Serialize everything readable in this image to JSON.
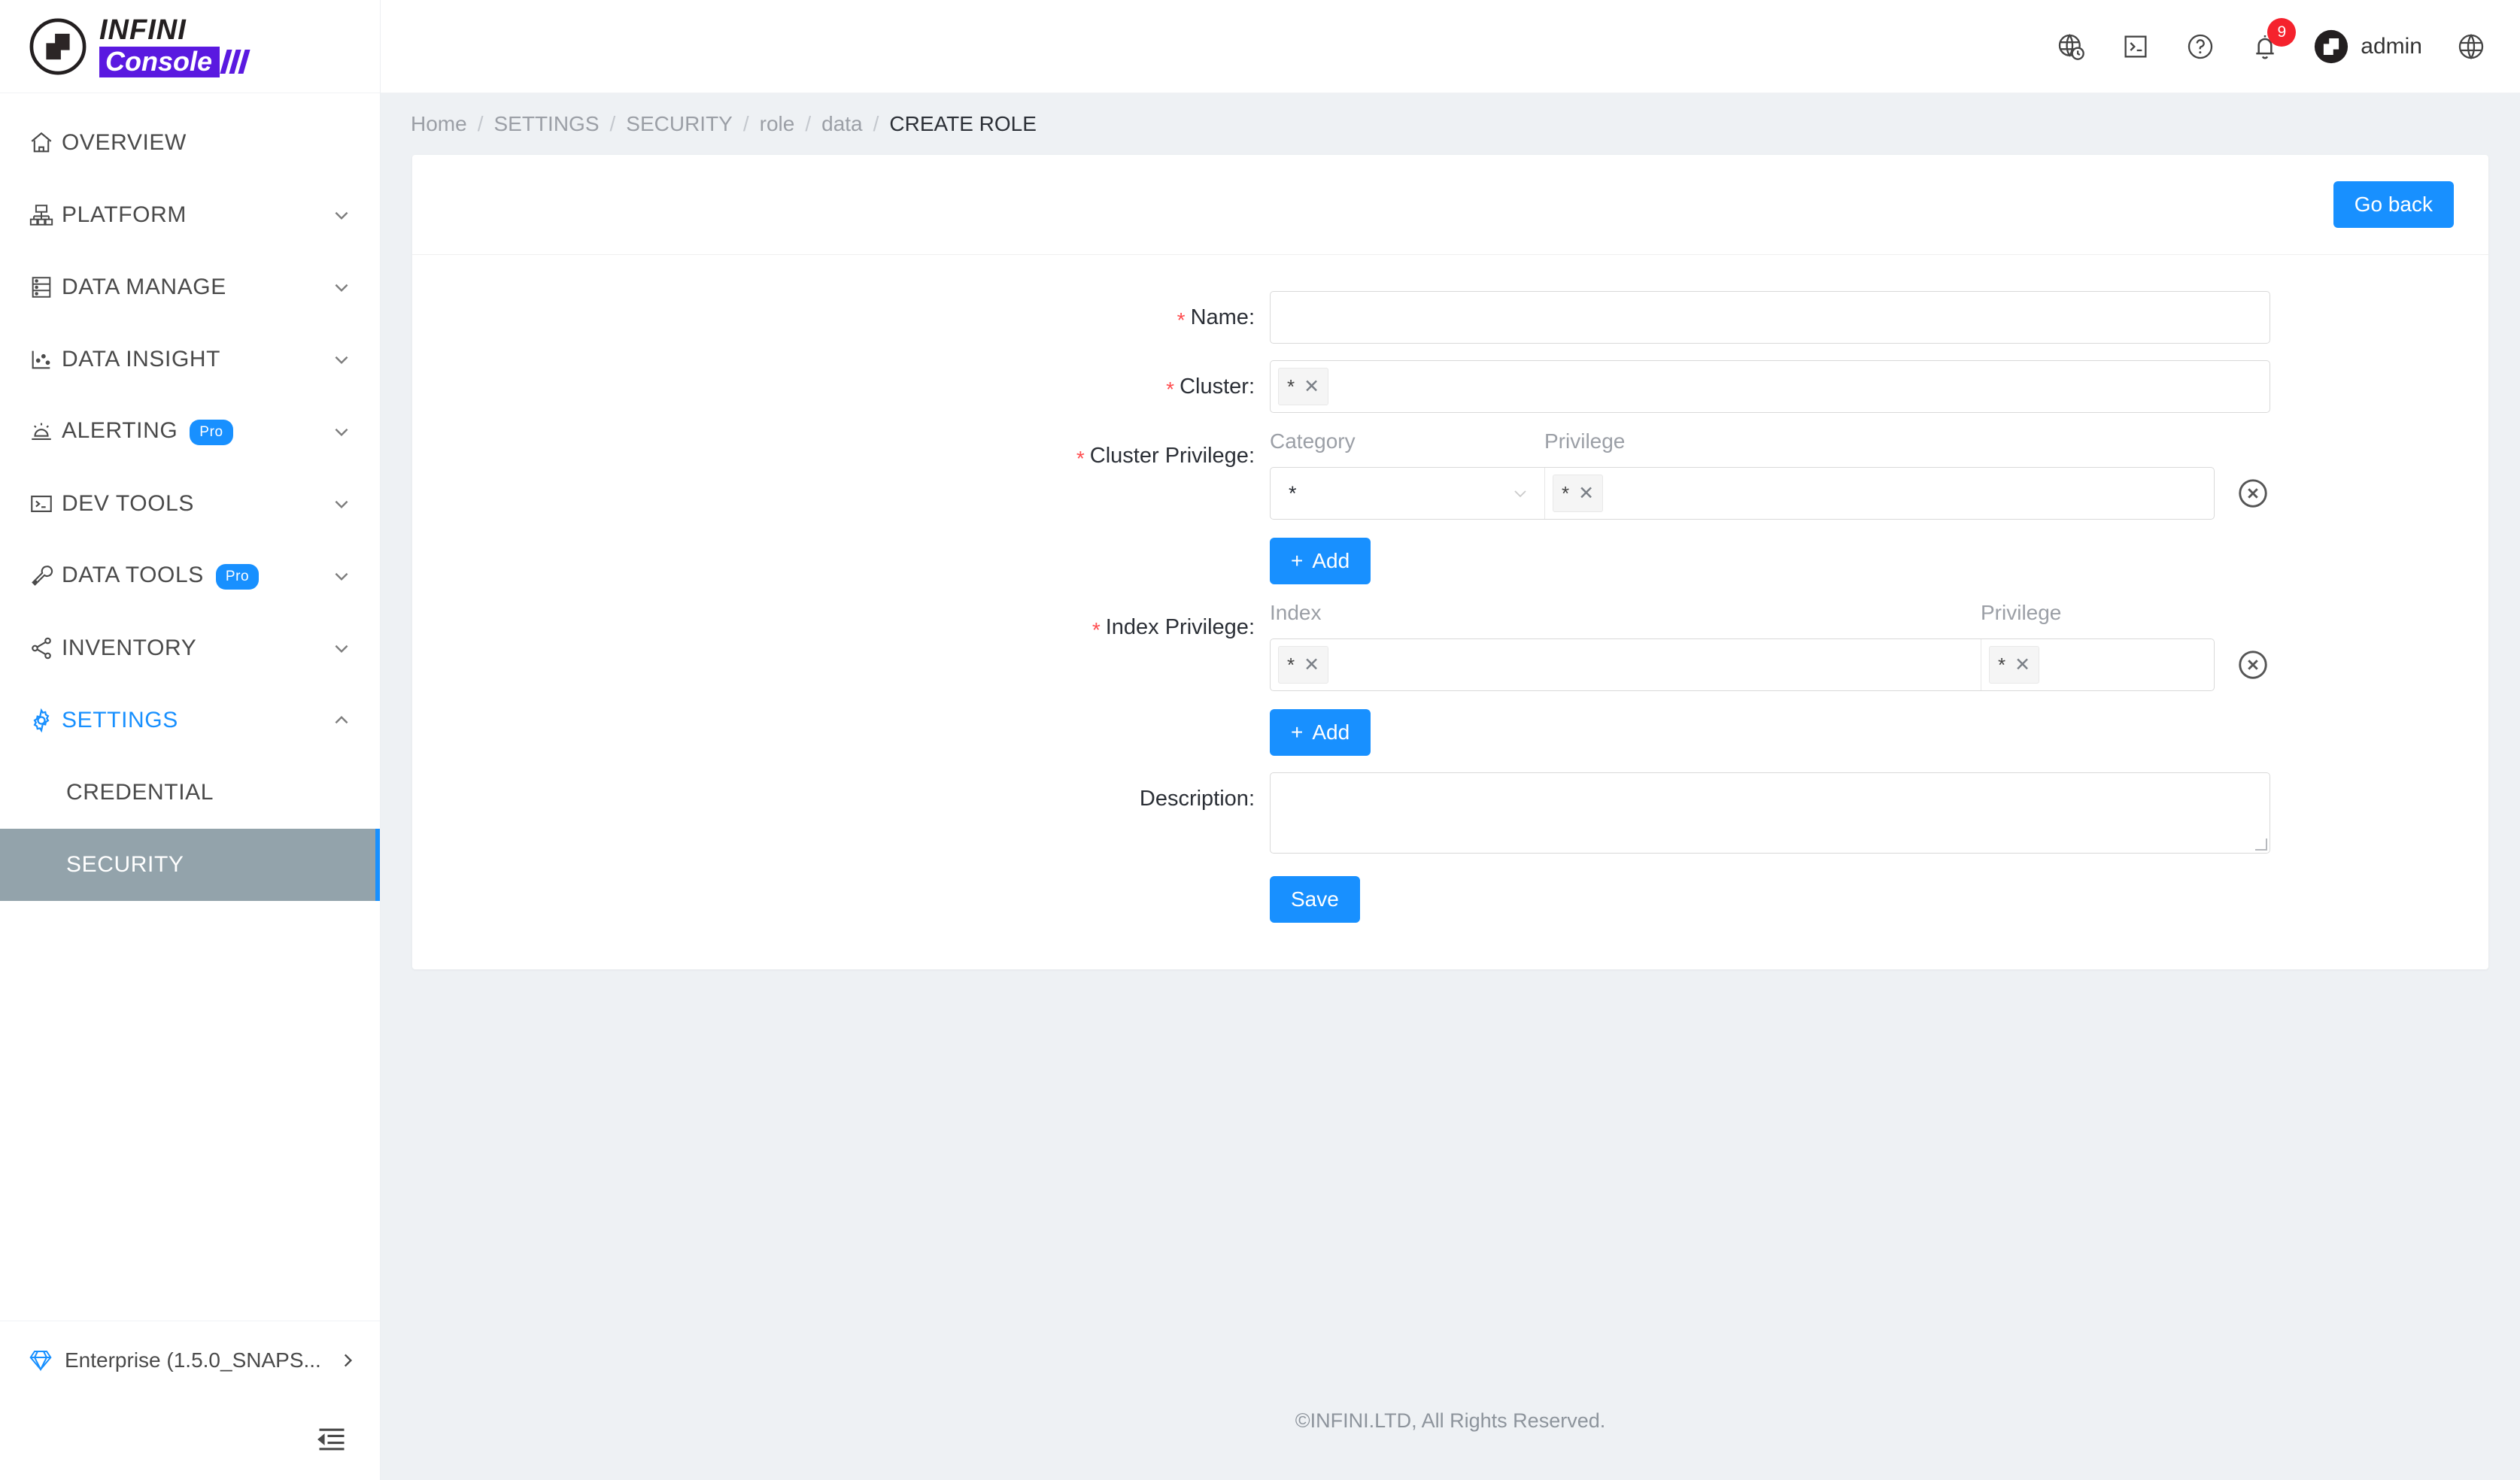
{
  "brand": {
    "name_top": "INFINI",
    "name_bottom": "Console",
    "logo_icon": "infini-n-logo-icon",
    "accent": "#5a19e0"
  },
  "sidebar": {
    "items": [
      {
        "label": "OVERVIEW",
        "icon": "home-icon",
        "expandable": false,
        "badge": null,
        "active": false
      },
      {
        "label": "PLATFORM",
        "icon": "platform-icon",
        "expandable": true,
        "badge": null,
        "active": false
      },
      {
        "label": "DATA MANAGE",
        "icon": "database-icon",
        "expandable": true,
        "badge": null,
        "active": false
      },
      {
        "label": "DATA INSIGHT",
        "icon": "chart-icon",
        "expandable": true,
        "badge": null,
        "active": false
      },
      {
        "label": "ALERTING",
        "icon": "alarm-icon",
        "expandable": true,
        "badge": "Pro",
        "active": false
      },
      {
        "label": "DEV TOOLS",
        "icon": "terminal-icon",
        "expandable": true,
        "badge": null,
        "active": false
      },
      {
        "label": "DATA TOOLS",
        "icon": "wrench-icon",
        "expandable": true,
        "badge": "Pro",
        "active": false
      },
      {
        "label": "INVENTORY",
        "icon": "share-nodes-icon",
        "expandable": true,
        "badge": null,
        "active": false
      },
      {
        "label": "SETTINGS",
        "icon": "gear-icon",
        "expandable": true,
        "badge": null,
        "active": true
      }
    ],
    "settings_children": [
      {
        "label": "CREDENTIAL",
        "selected": false
      },
      {
        "label": "SECURITY",
        "selected": true
      }
    ],
    "footer": {
      "label": "Enterprise (1.5.0_SNAPS...",
      "icon": "diamond-icon",
      "chevron": "chevron-right-icon"
    },
    "collapse_icon": "menu-fold-icon",
    "selected_bg": "#93a3ab",
    "active_color": "#1890ff"
  },
  "topbar": {
    "icons": [
      {
        "name": "globe-clock-icon"
      },
      {
        "name": "console-terminal-icon"
      },
      {
        "name": "help-circle-icon"
      },
      {
        "name": "bell-icon",
        "badge": "9"
      }
    ],
    "user": {
      "name": "admin",
      "avatar_icon": "infini-avatar-icon"
    },
    "language_icon": "language-globe-icon",
    "badge_color": "#f5222d"
  },
  "breadcrumb": {
    "items": [
      {
        "label": "Home",
        "current": false
      },
      {
        "label": "SETTINGS",
        "current": false
      },
      {
        "label": "SECURITY",
        "current": false
      },
      {
        "label": "role",
        "current": false
      },
      {
        "label": "data",
        "current": false
      },
      {
        "label": "CREATE ROLE",
        "current": true
      }
    ],
    "separator": "/"
  },
  "card": {
    "go_back_label": "Go back"
  },
  "form": {
    "name": {
      "label": "Name",
      "required": true,
      "value": "",
      "placeholder": ""
    },
    "cluster": {
      "label": "Cluster",
      "required": true,
      "tags": [
        {
          "text": "*",
          "close_icon": "tag-close-icon"
        }
      ]
    },
    "cluster_privilege": {
      "label": "Cluster Privilege",
      "required": true,
      "col_category": "Category",
      "col_privilege": "Privilege",
      "rows": [
        {
          "category_value": "*",
          "category_chevron": "chevron-down-icon",
          "privilege_tags": [
            {
              "text": "*",
              "close_icon": "tag-close-icon"
            }
          ],
          "delete_icon": "delete-circle-icon"
        }
      ],
      "add_label": "Add",
      "add_icon": "plus-icon"
    },
    "index_privilege": {
      "label": "Index Privilege",
      "required": true,
      "col_index": "Index",
      "col_privilege": "Privilege",
      "rows": [
        {
          "index_tags": [
            {
              "text": "*",
              "close_icon": "tag-close-icon"
            }
          ],
          "privilege_tags": [
            {
              "text": "*",
              "close_icon": "tag-close-icon"
            }
          ],
          "delete_icon": "delete-circle-icon"
        }
      ],
      "add_label": "Add",
      "add_icon": "plus-icon"
    },
    "description": {
      "label": "Description",
      "required": false,
      "value": "",
      "placeholder": ""
    },
    "save_label": "Save",
    "label_colon": ":",
    "required_mark": "*",
    "primary_color": "#1890ff",
    "required_color": "#ff4d4f"
  },
  "footer": {
    "copyright": "©INFINI.LTD, All Rights Reserved."
  }
}
